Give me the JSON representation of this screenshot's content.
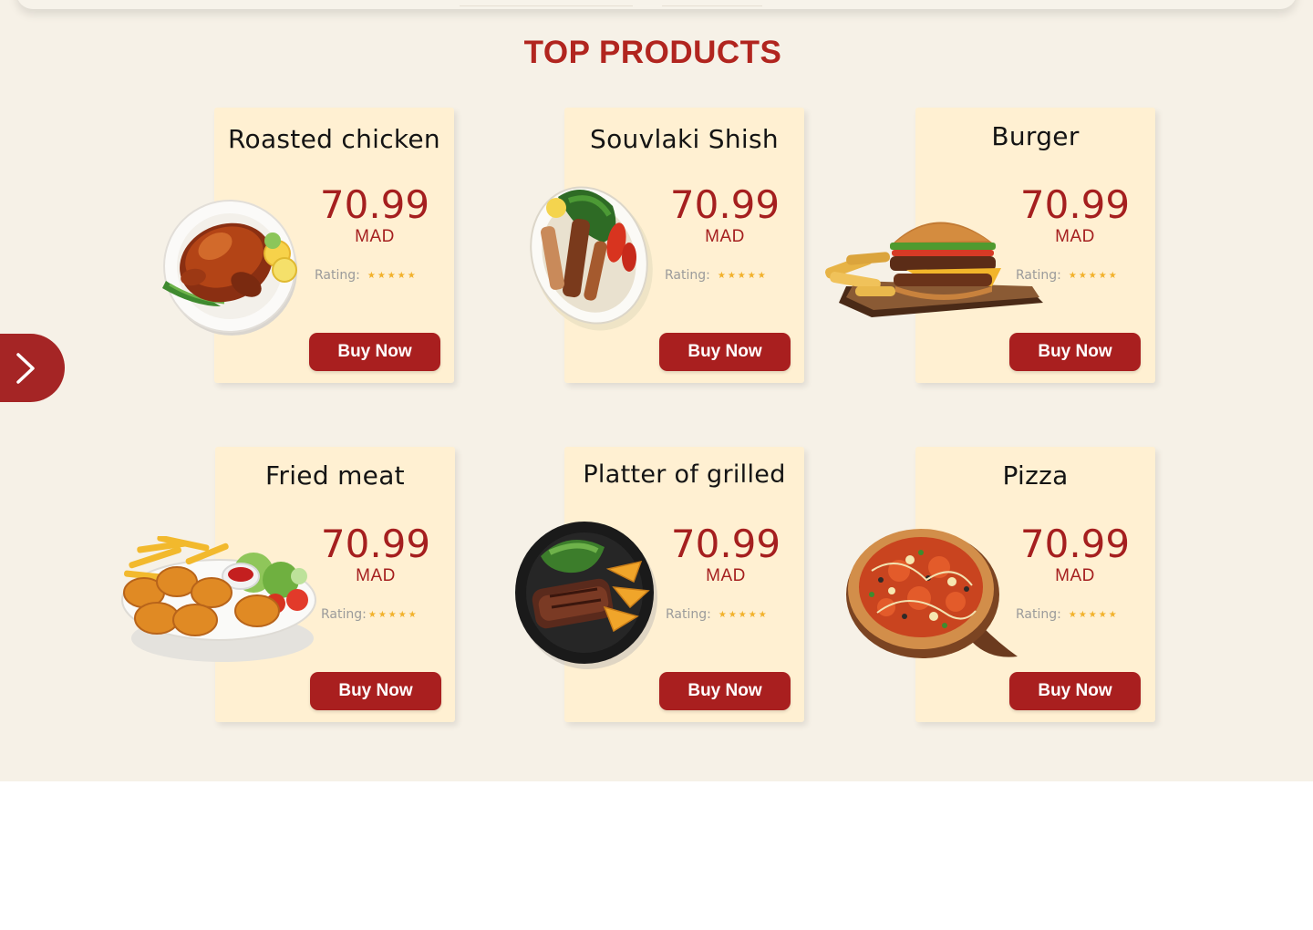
{
  "section": {
    "title": "TOP PRODUCTS"
  },
  "colors": {
    "brand": "#a91f1f",
    "title": "#b1251f",
    "card_bg": "#fff0d2",
    "section_bg": "#f6f1e7",
    "star": "#f2b12b"
  },
  "icons": {
    "next_arrow": "chevron-right-icon",
    "rating_stars": "star-icon"
  },
  "products": [
    {
      "name": "Roasted chicken",
      "price": "70.99",
      "currency": "MAD",
      "rating_label": "Rating:",
      "stars": "★★★★★",
      "button": "Buy Now",
      "image": "roasted-chicken-image"
    },
    {
      "name": "Souvlaki Shish",
      "price": "70.99",
      "currency": "MAD",
      "rating_label": "Rating:",
      "stars": "★★★★★",
      "button": "Buy Now",
      "image": "souvlaki-image"
    },
    {
      "name": "Burger",
      "price": "70.99",
      "currency": "MAD",
      "rating_label": "Rating:",
      "stars": "★★★★★",
      "button": "Buy Now",
      "image": "burger-image"
    },
    {
      "name": "Fried meat",
      "price": "70.99",
      "currency": "MAD",
      "rating_label": "Rating:",
      "stars": "★★★★★",
      "button": "Buy Now",
      "image": "fried-meat-image"
    },
    {
      "name": "Platter of grilled",
      "price": "70.99",
      "currency": "MAD",
      "rating_label": "Rating:",
      "stars": "★★★★★",
      "button": "Buy Now",
      "image": "grilled-platter-image"
    },
    {
      "name": "Pizza",
      "price": "70.99",
      "currency": "MAD",
      "rating_label": "Rating:",
      "stars": "★★★★★",
      "button": "Buy Now",
      "image": "pizza-image"
    }
  ]
}
